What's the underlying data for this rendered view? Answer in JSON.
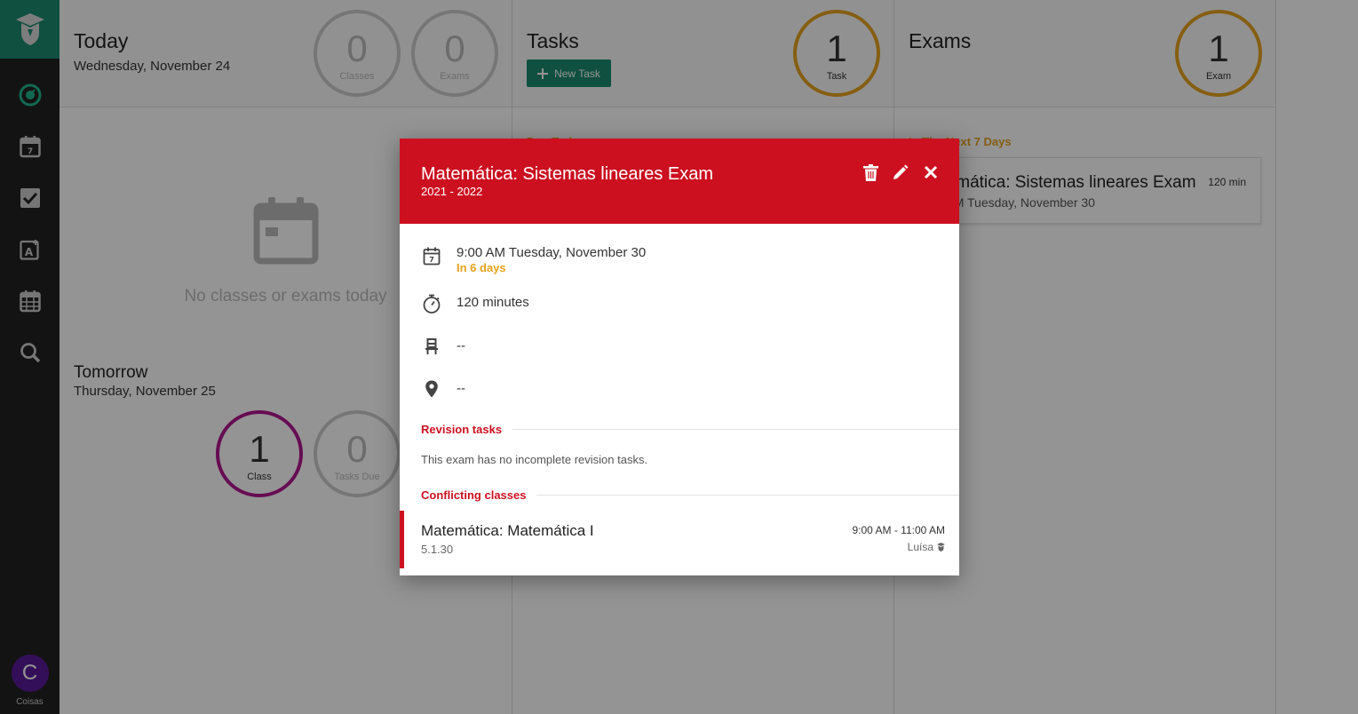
{
  "colors": {
    "accent": "#1a8a6e",
    "exam_red": "#cc1020",
    "warning_orange": "#e6a21e",
    "class_purple": "#b0168f",
    "sidebar_bg": "#222222"
  },
  "sidebar": {
    "items": [
      {
        "icon": "dashboard-icon"
      },
      {
        "icon": "calendar-day-icon"
      },
      {
        "icon": "tasks-check-icon"
      },
      {
        "icon": "exam-add-icon"
      },
      {
        "icon": "schedule-grid-icon"
      },
      {
        "icon": "search-icon"
      }
    ],
    "user": {
      "initial": "C",
      "name": "Coisas"
    }
  },
  "today": {
    "title": "Today",
    "date": "Wednesday, November 24",
    "classes_count": "0",
    "classes_label": "Classes",
    "exams_count": "0",
    "exams_label": "Exams",
    "empty_text": "No classes or exams today"
  },
  "tomorrow": {
    "title": "Tomorrow",
    "date": "Thursday, November 25",
    "class_count": "1",
    "class_label": "Class",
    "tasks_count": "0",
    "tasks_label": "Tasks Due"
  },
  "tasks": {
    "title": "Tasks",
    "new_task_label": "New Task",
    "count": "1",
    "count_label": "Task",
    "section_label": "Due Today"
  },
  "exams": {
    "title": "Exams",
    "count": "1",
    "count_label": "Exam",
    "section_label": "In The Next 7 Days",
    "card_title": "Matemática: Sistemas lineares Exam",
    "card_date": "9:00 AM Tuesday, November 30",
    "card_duration": "120 min"
  },
  "modal": {
    "title": "Matemática: Sistemas lineares Exam",
    "subtitle": "2021 - 2022",
    "datetime": "9:00 AM Tuesday, November 30",
    "relative": "In 6 days",
    "duration": "120 minutes",
    "seat": "--",
    "location": "--",
    "revision_heading": "Revision tasks",
    "revision_note": "This exam has no incomplete revision tasks.",
    "conflict_heading": "Conflicting classes",
    "conflict": {
      "name": "Matemática: Matemática I",
      "room": "5.1.30",
      "time": "9:00 AM - 11:00 AM",
      "teacher": "Luísa"
    }
  }
}
